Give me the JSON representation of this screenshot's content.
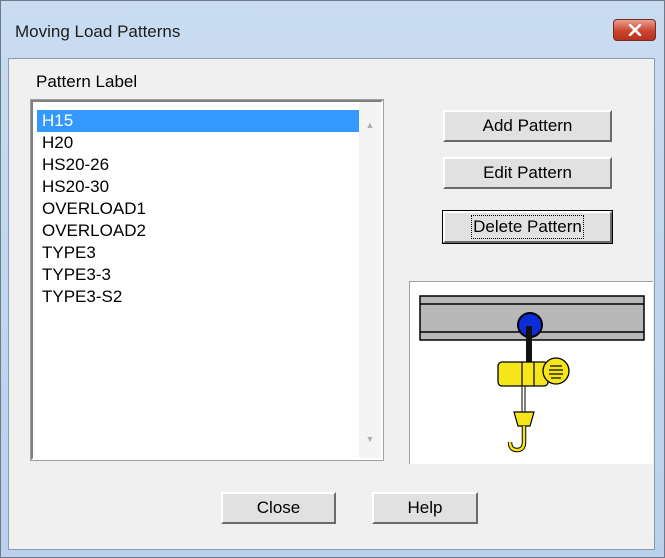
{
  "window": {
    "title": "Moving Load Patterns"
  },
  "colors": {
    "selection": "#3399ff",
    "close_button": "#c9452f",
    "hoist_yellow": "#f5e61a",
    "trolley_blue": "#0b2cd6"
  },
  "icons": {
    "close": "close-icon",
    "scroll_up": "chevron-up-icon",
    "scroll_down": "chevron-down-icon"
  },
  "list": {
    "label": "Pattern Label",
    "selected": "H15",
    "items": [
      "H15",
      "H20",
      "HS20-26",
      "HS20-30",
      "OVERLOAD1",
      "OVERLOAD2",
      "TYPE3",
      "TYPE3-3",
      "TYPE3-S2"
    ]
  },
  "buttons": {
    "add": "Add Pattern",
    "edit": "Edit Pattern",
    "delete": "Delete Pattern",
    "close": "Close",
    "help": "Help"
  }
}
